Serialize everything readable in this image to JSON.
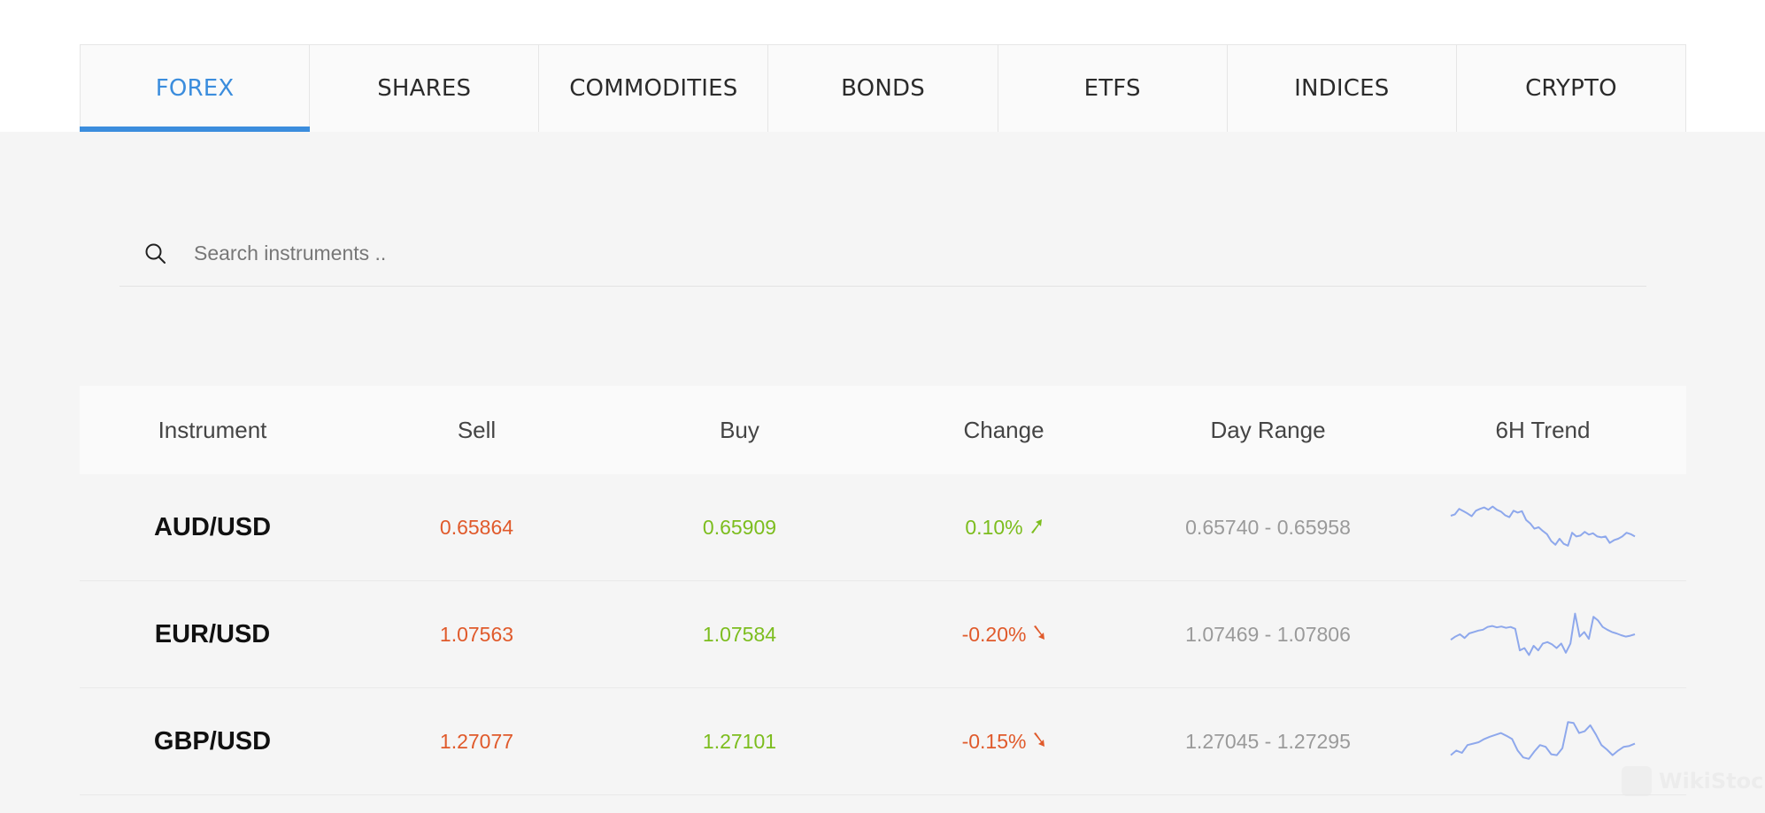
{
  "tabs": [
    {
      "label": "FOREX",
      "active": true
    },
    {
      "label": "SHARES",
      "active": false
    },
    {
      "label": "COMMODITIES",
      "active": false
    },
    {
      "label": "BONDS",
      "active": false
    },
    {
      "label": "ETFS",
      "active": false
    },
    {
      "label": "INDICES",
      "active": false
    },
    {
      "label": "CRYPTO",
      "active": false
    }
  ],
  "search": {
    "placeholder": "Search instruments ..",
    "value": "",
    "icon": "search-icon"
  },
  "table": {
    "headers": [
      "Instrument",
      "Sell",
      "Buy",
      "Change",
      "Day Range",
      "6H Trend"
    ],
    "rows": [
      {
        "instrument": "AUD/USD",
        "sell": "0.65864",
        "buy": "0.65909",
        "change": "0.10%",
        "direction": "up",
        "day_range": "0.65740 - 0.65958",
        "trend": [
          0.75,
          0.78,
          0.9,
          0.85,
          0.8,
          0.74,
          0.86,
          0.9,
          0.93,
          0.88,
          0.95,
          0.88,
          0.84,
          0.76,
          0.72,
          0.86,
          0.82,
          0.85,
          0.66,
          0.58,
          0.47,
          0.5,
          0.42,
          0.35,
          0.2,
          0.12,
          0.25,
          0.14,
          0.1,
          0.38,
          0.3,
          0.32,
          0.4,
          0.34,
          0.37,
          0.3,
          0.28,
          0.3,
          0.16,
          0.22,
          0.25,
          0.3,
          0.38,
          0.35,
          0.3
        ]
      },
      {
        "instrument": "EUR/USD",
        "sell": "1.07563",
        "buy": "1.07584",
        "change": "-0.20%",
        "direction": "down",
        "day_range": "1.07469 - 1.07806",
        "trend": [
          0.38,
          0.45,
          0.5,
          0.42,
          0.52,
          0.55,
          0.58,
          0.6,
          0.66,
          0.68,
          0.65,
          0.67,
          0.64,
          0.66,
          0.62,
          0.15,
          0.2,
          0.05,
          0.25,
          0.15,
          0.3,
          0.33,
          0.28,
          0.2,
          0.3,
          0.1,
          0.3,
          0.95,
          0.45,
          0.55,
          0.4,
          0.88,
          0.8,
          0.66,
          0.6,
          0.55,
          0.52,
          0.48,
          0.45,
          0.47,
          0.5
        ]
      },
      {
        "instrument": "GBP/USD",
        "sell": "1.27077",
        "buy": "1.27101",
        "change": "-0.15%",
        "direction": "down",
        "day_range": "1.27045 - 1.27295",
        "trend": [
          0.2,
          0.3,
          0.25,
          0.42,
          0.45,
          0.48,
          0.55,
          0.6,
          0.64,
          0.68,
          0.62,
          0.55,
          0.3,
          0.15,
          0.12,
          0.28,
          0.42,
          0.38,
          0.22,
          0.2,
          0.35,
          0.92,
          0.9,
          0.68,
          0.72,
          0.85,
          0.65,
          0.42,
          0.32,
          0.2,
          0.3,
          0.38,
          0.4,
          0.45
        ]
      }
    ]
  },
  "colors": {
    "accent": "#3b8ddd",
    "up": "#7cbd1e",
    "down": "#e05a2b",
    "spark": "#8ea8ec"
  },
  "watermark": "WikiStock"
}
